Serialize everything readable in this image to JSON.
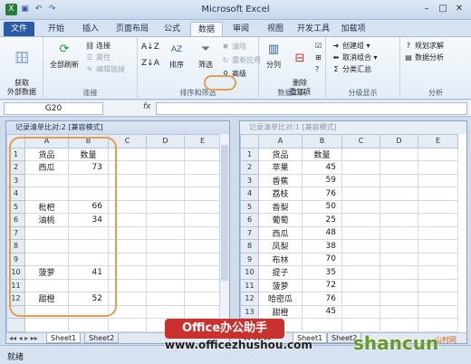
{
  "window": {
    "title": "Microsoft Excel"
  },
  "qat": {
    "icons": [
      "excel-logo-icon",
      "save-icon",
      "undo-icon",
      "redo-icon"
    ]
  },
  "tabs": [
    "文件",
    "开始",
    "插入",
    "页面布局",
    "公式",
    "数据",
    "审阅",
    "视图",
    "开发工具",
    "加载项"
  ],
  "ribbon": {
    "get_external": "获取\n外部数据",
    "refresh_all": "全部刷新",
    "connections": "连接",
    "properties": "属性",
    "edit_links": "编辑链接",
    "sort": "排序",
    "filter": "筛选",
    "clear": "清除",
    "reapply": "重新应用",
    "advanced": "高级",
    "text_to_cols": "分列",
    "remove_dup": "删除\n重复项",
    "create_group": "创建组",
    "ungroup": "取消组合",
    "subtotal": "分类汇总",
    "solver": "规划求解",
    "data_analysis": "数据分析",
    "groups": {
      "connections": "连接",
      "sort_filter": "排序和筛选",
      "data_tools": "数据工具",
      "outline": "分级显示",
      "analysis": "分析"
    }
  },
  "formula": {
    "cell_ref": "G20",
    "fx": "fx",
    "value": ""
  },
  "left_window": {
    "title": "记录清单比对:2  [兼容模式]",
    "columns": [
      "A",
      "B",
      "C",
      "D",
      "E"
    ],
    "rows": [
      [
        "1",
        "货品",
        "数量"
      ],
      [
        "2",
        "西瓜",
        "73"
      ],
      [
        "3",
        "",
        ""
      ],
      [
        "4",
        "",
        ""
      ],
      [
        "5",
        "枇杷",
        "66"
      ],
      [
        "6",
        "油桃",
        "34"
      ],
      [
        "7",
        "",
        ""
      ],
      [
        "8",
        "",
        ""
      ],
      [
        "9",
        "",
        ""
      ],
      [
        "10",
        "菠萝",
        "41"
      ],
      [
        "11",
        "",
        ""
      ],
      [
        "12",
        "甜橙",
        "52"
      ]
    ],
    "sheet_tabs": [
      "Sheet1",
      "Sheet2"
    ]
  },
  "right_window": {
    "title": "记录清单比对:1  [兼容模式]",
    "columns": [
      "A",
      "B",
      "C",
      "D",
      "E"
    ],
    "rows": [
      [
        "1",
        "货品",
        "数量"
      ],
      [
        "2",
        "苹果",
        "45"
      ],
      [
        "3",
        "香蕉",
        "59"
      ],
      [
        "4",
        "荔枝",
        "76"
      ],
      [
        "5",
        "香梨",
        "50"
      ],
      [
        "6",
        "葡萄",
        "25"
      ],
      [
        "7",
        "西瓜",
        "48"
      ],
      [
        "8",
        "凤梨",
        "38"
      ],
      [
        "9",
        "布林",
        "70"
      ],
      [
        "10",
        "提子",
        "35"
      ],
      [
        "11",
        "菠萝",
        "72"
      ],
      [
        "12",
        "哈密瓜",
        "76"
      ],
      [
        "13",
        "甜橙",
        "45"
      ]
    ],
    "sheet_tabs": [
      "Sheet1",
      "Sheet2"
    ]
  },
  "status": {
    "text": "就绪"
  },
  "watermark": {
    "brand": "Office办公助手",
    "url": "www.officezhushou.com",
    "shancun": "shancun",
    "shancun_cn": "山村网"
  }
}
